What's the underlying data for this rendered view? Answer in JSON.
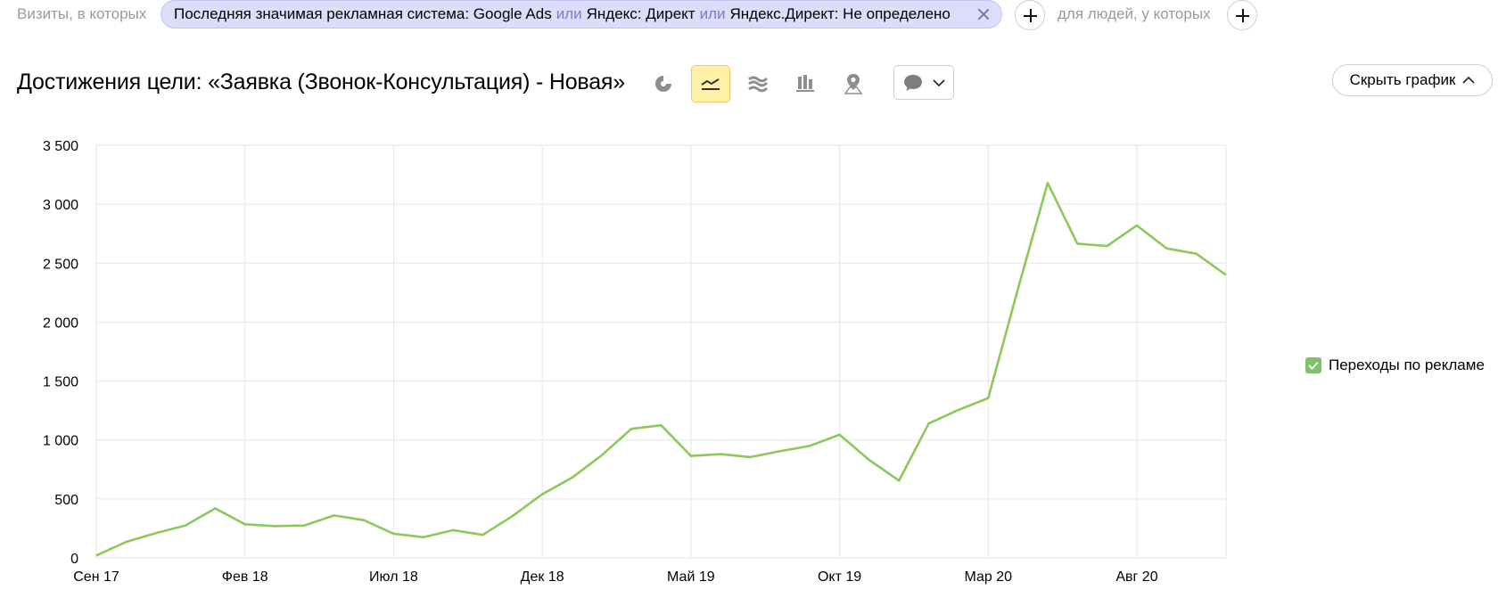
{
  "filter": {
    "visits_label": "Визиты, в которых",
    "chip_parts": [
      "Последняя значимая рекламная система: Google Ads",
      "или",
      "Яндекс: Директ",
      "или",
      "Яндекс.Директ: Не определено"
    ],
    "people_label": "для людей, у которых"
  },
  "header": {
    "title": "Достижения цели: «Заявка (Звонок-Консультация) - Новая»",
    "hide_chart_label": "Скрыть график"
  },
  "toolbar": {
    "icons": [
      "pie-chart-icon",
      "line-chart-icon",
      "area-chart-icon",
      "bar-chart-icon",
      "map-icon",
      "comment-icon"
    ],
    "active": "line-chart-icon"
  },
  "colors": {
    "series": "#8cc85a",
    "grid": "#e6e6e6",
    "active_tool": "#fff1a8",
    "chip": "#dcdcfb"
  },
  "legend": {
    "label": "Переходы по рекламе",
    "checked": true
  },
  "chart_data": {
    "type": "line",
    "title": "",
    "xlabel": "",
    "ylabel": "",
    "ylim": [
      0,
      3500
    ],
    "yticks": [
      0,
      500,
      1000,
      1500,
      2000,
      2500,
      3000,
      3500
    ],
    "ytick_labels": [
      "0",
      "500",
      "1 000",
      "1 500",
      "2 000",
      "2 500",
      "3 000",
      "3 500"
    ],
    "xtick_labels": [
      "Сен 17",
      "Фев 18",
      "Июл 18",
      "Дек 18",
      "Май 19",
      "Окт 19",
      "Мар 20",
      "Авг 20"
    ],
    "xtick_month_index": [
      0,
      5,
      10,
      15,
      20,
      25,
      30,
      35
    ],
    "grid": true,
    "legend_position": "right",
    "series": [
      {
        "name": "Переходы по рекламе",
        "values": [
          20,
          135,
          210,
          275,
          420,
          285,
          270,
          275,
          360,
          320,
          205,
          175,
          235,
          195,
          355,
          540,
          680,
          870,
          1095,
          1125,
          865,
          880,
          855,
          905,
          950,
          1045,
          830,
          655,
          1140,
          1255,
          1355,
          2280,
          3180,
          2665,
          2645,
          2820,
          2625,
          2580,
          2400
        ]
      }
    ]
  }
}
